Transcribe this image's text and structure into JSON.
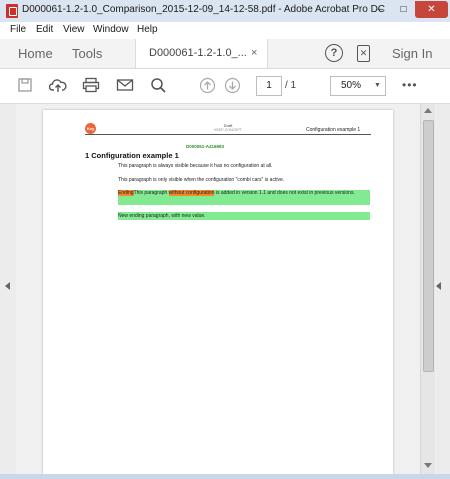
{
  "window": {
    "title": "D000061-1.2-1.0_Comparison_2015-12-09_14-12-58.pdf - Adobe Acrobat Pro DC",
    "minimize": "–",
    "maximize": "□",
    "close": "✕"
  },
  "menu": [
    "File",
    "Edit",
    "View",
    "Window",
    "Help"
  ],
  "nav": {
    "home": "Home",
    "tools": "Tools",
    "tab_label": "D000061-1.2-1.0_...",
    "tab_close": "×",
    "help": "?",
    "sign_in": "Sign In"
  },
  "toolbar": {
    "page_current": "1",
    "page_total": "/ 1",
    "zoom": "50%",
    "more": "•••"
  },
  "document": {
    "logo_text": "Key",
    "header_center_line1": "Draft",
    "header_center_line2": "KEEP-CONCEPT",
    "header_right": "Configuration example 1",
    "doc_id": "D000061-A416993",
    "section_title": "1 Configuration example 1",
    "paragraph1": "This paragraph is always visible because it has no configuration at all.",
    "paragraph2": "This paragraph is only visible when the configuration \"combi cars\" is active.",
    "paragraph3_part1": "Ending",
    "paragraph3_part2": "This paragraph",
    "paragraph3_part3": "without configuration",
    "paragraph3_part4": "is added in version 1.1 and does not exist in previous versions.",
    "paragraph4": "New ending paragraph, with new value."
  },
  "colors": {
    "added_highlight": "#82ea90",
    "removed_highlight": "#f08a2c",
    "close_button": "#c7463b"
  }
}
